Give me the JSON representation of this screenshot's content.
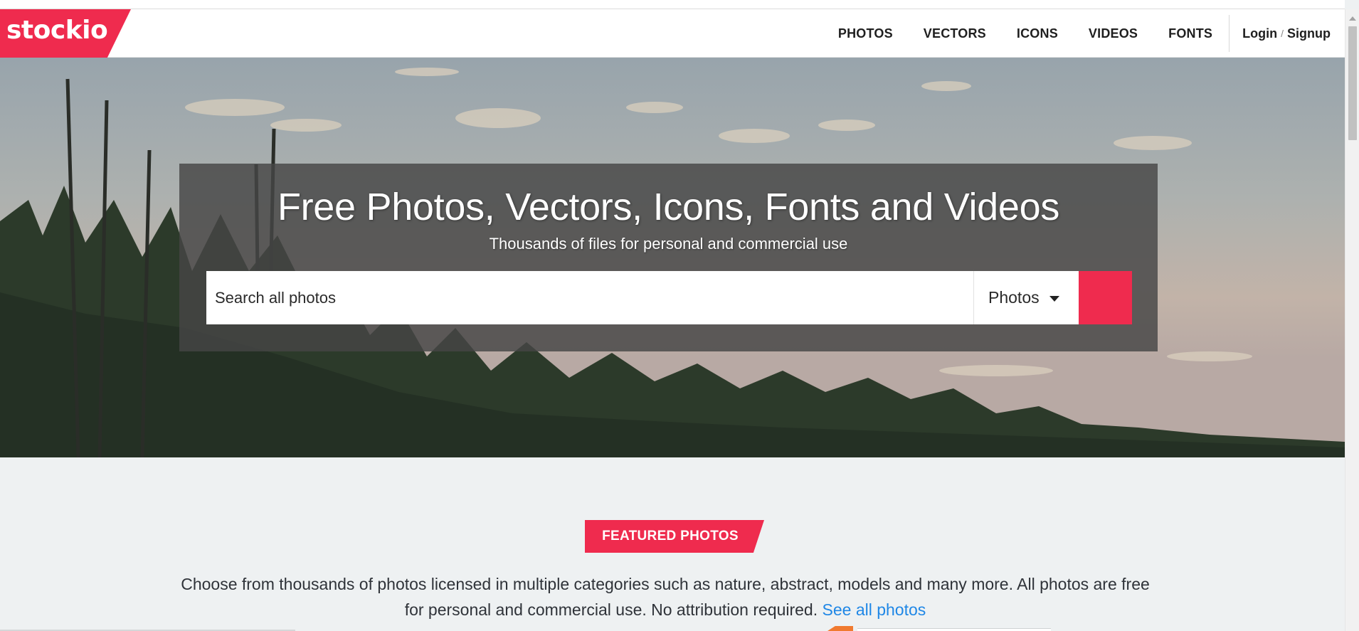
{
  "brand": {
    "logo_text": "stockio",
    "accent": "#ef2b4e"
  },
  "nav": {
    "items": [
      "PHOTOS",
      "VECTORS",
      "ICONS",
      "VIDEOS",
      "FONTS"
    ],
    "login": "Login",
    "separator": "/",
    "signup": "Signup"
  },
  "hero": {
    "title": "Free Photos, Vectors, Icons, Fonts and Videos",
    "subtitle": "Thousands of files for personal and commercial use",
    "search_placeholder": "Search all photos",
    "type_selected": "Photos",
    "search_icon": "search-icon"
  },
  "featured": {
    "badge": "FEATURED PHOTOS",
    "description": "Choose from thousands of photos licensed in multiple categories such as nature, abstract, models and many more. All photos are free for personal and commercial use. No attribution required.",
    "link": "See all photos",
    "link_color": "#1f87e6"
  }
}
